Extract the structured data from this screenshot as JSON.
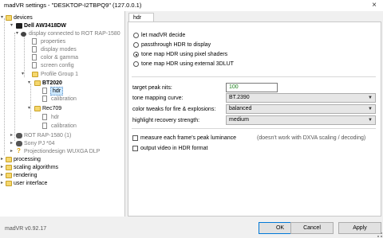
{
  "window": {
    "title": "madVR settings - \"DESKTOP-I2TBPQ9\" (127.0.0.1)",
    "close_glyph": "×"
  },
  "tree": {
    "devices": "devices",
    "dell": "Dell AW3418DW",
    "display_connected": "display connected to ROT RAP-1580",
    "properties": "properties",
    "display_modes": "display modes",
    "color_gamma": "color & gamma",
    "screen_config": "screen config",
    "profile_group": "Profile Group 1",
    "bt2020": "BT2020",
    "hdr": "hdr",
    "calibration": "calibration",
    "rec709": "Rec709",
    "hdr2": "hdr",
    "calibration2": "calibration",
    "rot": "ROT RAP-1580 (1)",
    "sony": "Sony PJ *04",
    "projectiondesign": "Projectiondesign WUXGA DLP",
    "processing": "processing",
    "scaling": "scaling algorithms",
    "rendering": "rendering",
    "ui": "user interface"
  },
  "tab": {
    "label": "hdr"
  },
  "hdr_modes": [
    {
      "label": "let madVR decide",
      "selected": false
    },
    {
      "label": "passthrough HDR to display",
      "selected": false
    },
    {
      "label": "tone map HDR using pixel shaders",
      "selected": true
    },
    {
      "label": "tone map HDR using external 3DLUT",
      "selected": false
    }
  ],
  "fields": {
    "target_peak_label": "target peak nits:",
    "target_peak_value": "100",
    "curve_label": "tone mapping curve:",
    "curve_value": "BT.2390",
    "color_tweaks_label": "color tweaks for fire & explosions:",
    "color_tweaks_value": "balanced",
    "highlight_label": "highlight recovery strength:",
    "highlight_value": "medium"
  },
  "checks": {
    "measure_label": "measure each frame's peak luminance",
    "measure_note": "(doesn't work with DXVA scaling / decoding)",
    "output_label": "output video in HDR format"
  },
  "footer": {
    "version": "madVR v0.92.17",
    "ok": "OK",
    "cancel": "Cancel",
    "apply": "Apply"
  },
  "colors": {
    "accent": "#0078d7",
    "selection": "#cce8ff",
    "value_green": "#1a7f1a"
  }
}
